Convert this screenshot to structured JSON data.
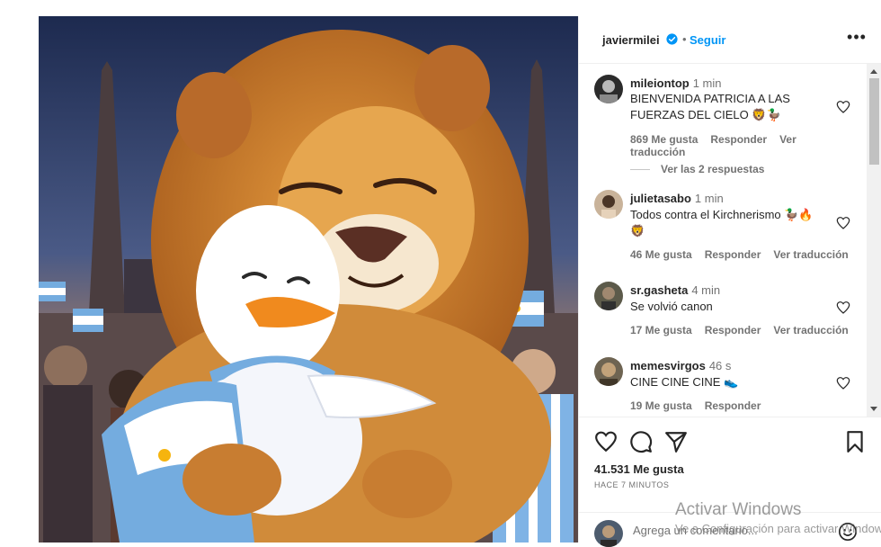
{
  "post": {
    "author": "javiermilei",
    "verified": true,
    "separator": "•",
    "follow_label": "Seguir",
    "more_icon": "more-horizontal-icon",
    "image_alt": "Ilustración: un león abraza a un pato con bandera argentina"
  },
  "comments": [
    {
      "user": "mileiontop",
      "time": "1 min",
      "text": "BIENVENIDA PATRICIA A LAS FUERZAS DEL CIELO 🦁🦆",
      "likes": "869 Me gusta",
      "reply": "Responder",
      "translate": "Ver traducción",
      "replies": "Ver las 2 respuestas"
    },
    {
      "user": "julietasabo",
      "time": "1 min",
      "text": "Todos contra el Kirchnerismo 🦆🔥 🦁",
      "likes": "46 Me gusta",
      "reply": "Responder",
      "translate": "Ver traducción"
    },
    {
      "user": "sr.gasheta",
      "time": "4 min",
      "text": "Se volvió canon",
      "likes": "17 Me gusta",
      "reply": "Responder",
      "translate": "Ver traducción"
    },
    {
      "user": "memesvirgos",
      "time": "46 s",
      "text": "CINE CINE CINE 👟",
      "likes": "19 Me gusta",
      "reply": "Responder"
    }
  ],
  "actions": {
    "likes": "41.531 Me gusta",
    "posted": "HACE 7 MINUTOS",
    "comment_placeholder": "Agrega un comentario..."
  },
  "overlay": {
    "line1": "Activar Windows",
    "line2": "Ve a Configuración para activar Windows."
  },
  "colors": {
    "link": "#0095f6",
    "secondary": "#737373",
    "text": "#262626",
    "border": "#efefef",
    "verified": "#0095f6"
  }
}
